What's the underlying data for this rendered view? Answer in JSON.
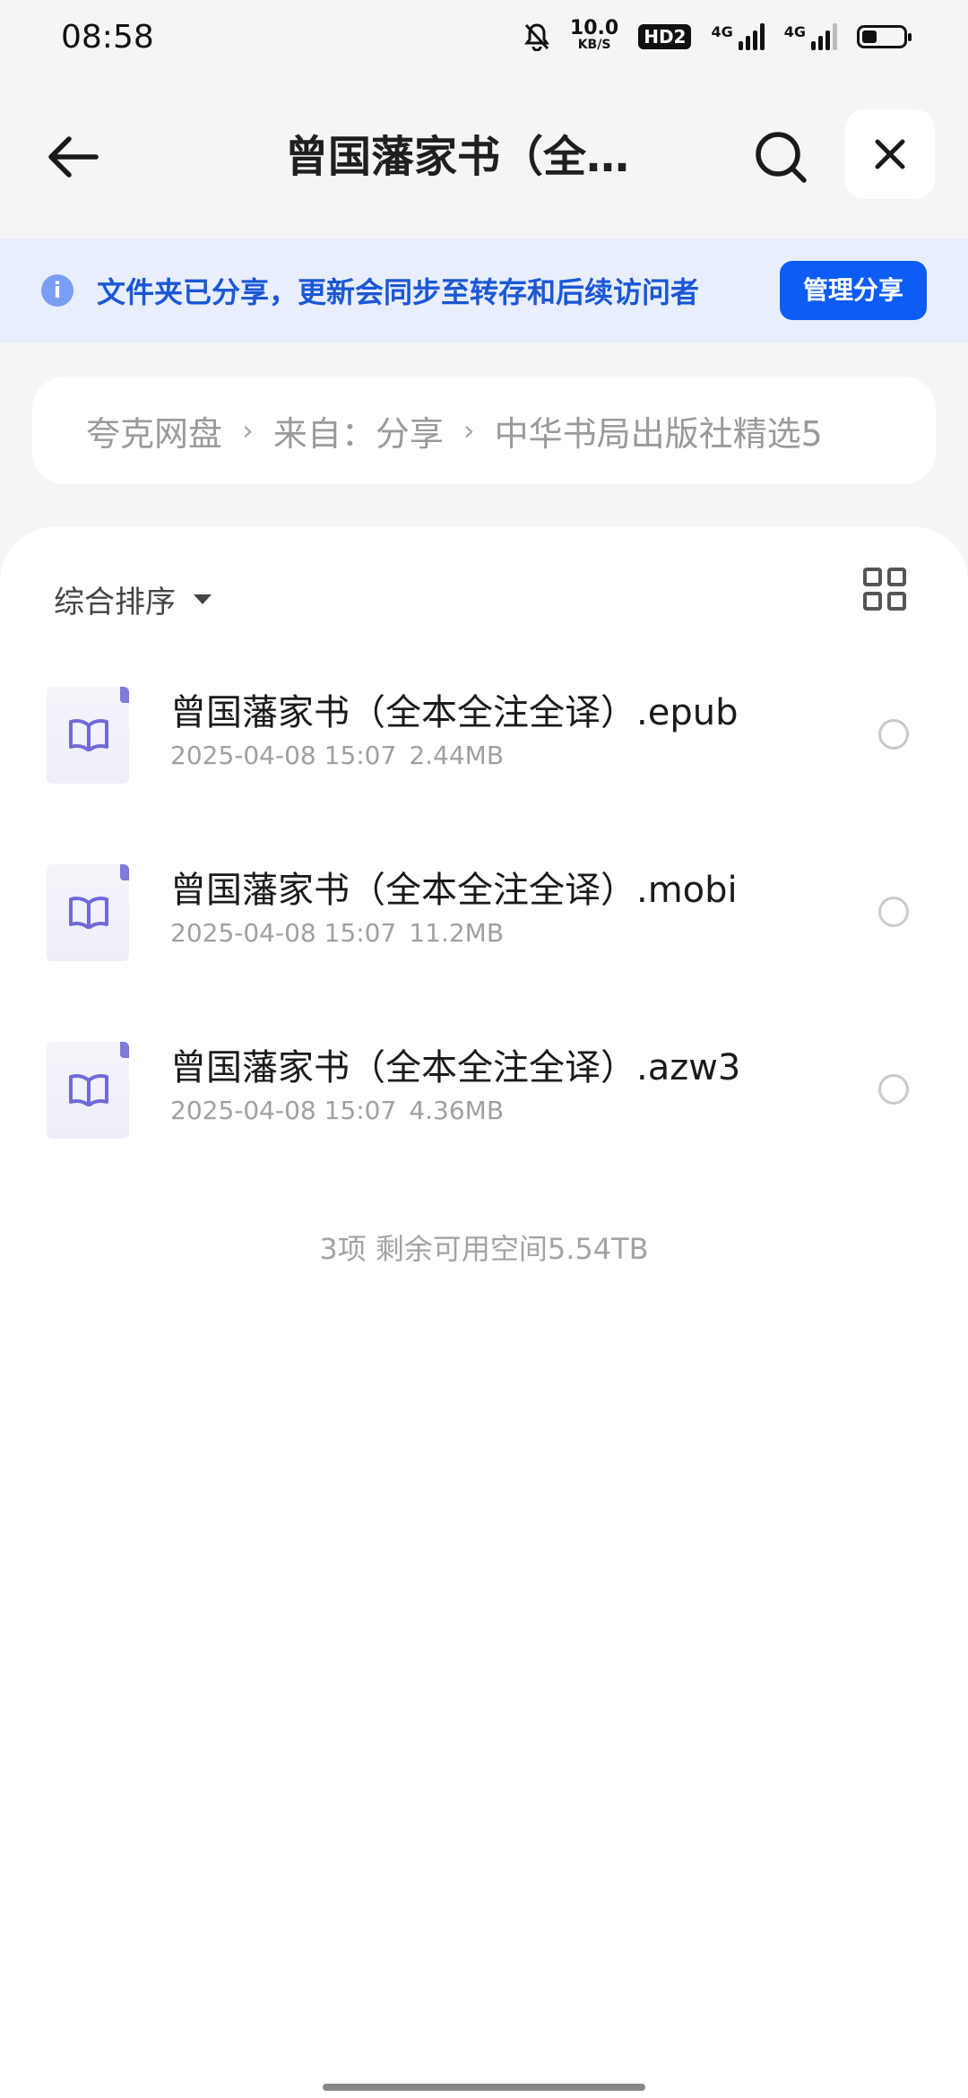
{
  "status_bar": {
    "time": "08:58",
    "speed_value": "10.0",
    "speed_unit": "KB/S",
    "hd_label": "HD2",
    "net1": "4G",
    "net2": "4G",
    "icons": [
      "bell-off-icon",
      "signal-icon",
      "battery-icon"
    ]
  },
  "header": {
    "title": "曾国藩家书（全本..."
  },
  "notice": {
    "text": "文件夹已分享，更新会同步至转存和后续访问者",
    "button": "管理分享",
    "accent": "#0d5cf6"
  },
  "breadcrumb": {
    "items": [
      "夸克网盘",
      "来自：分享",
      "中华书局出版社精选5"
    ]
  },
  "toolbar": {
    "sort_label": "综合排序"
  },
  "files": [
    {
      "name": "曾国藩家书（全本全注全译）.epub",
      "date": "2025-04-08 15:07",
      "size": "2.44MB"
    },
    {
      "name": "曾国藩家书（全本全注全译）.mobi",
      "date": "2025-04-08 15:07",
      "size": "11.2MB"
    },
    {
      "name": "曾国藩家书（全本全注全译）.azw3",
      "date": "2025-04-08 15:07",
      "size": "4.36MB"
    }
  ],
  "summary": "3项 剩余可用空间5.54TB"
}
